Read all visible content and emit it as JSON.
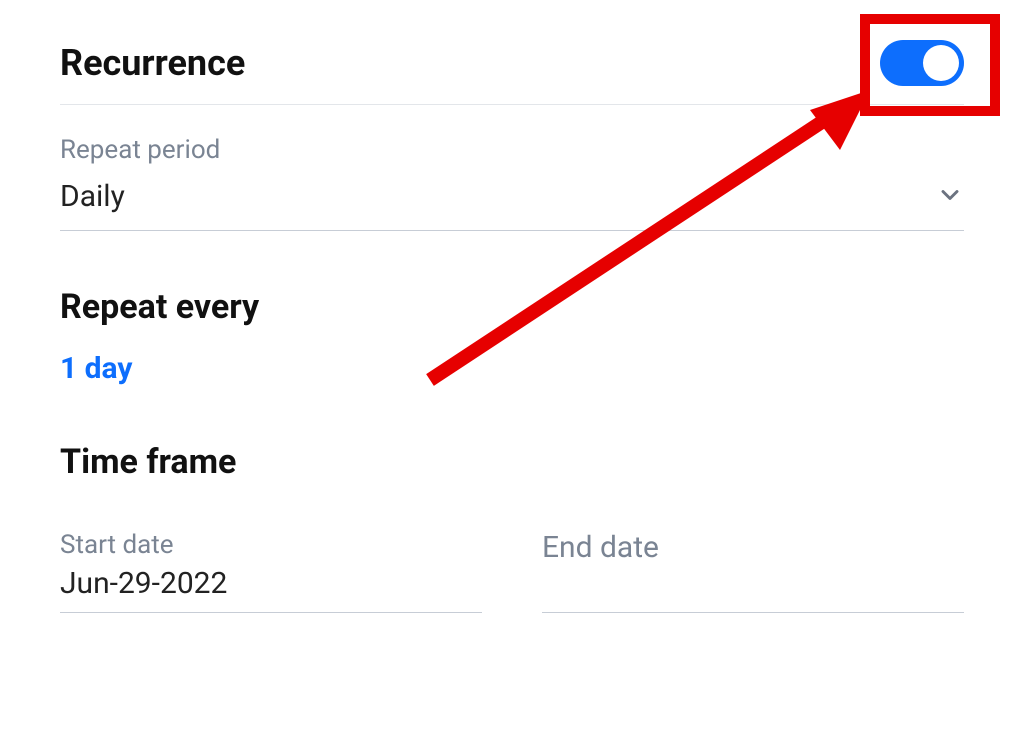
{
  "recurrence": {
    "title": "Recurrence",
    "toggle_on": true
  },
  "repeat_period": {
    "label": "Repeat period",
    "value": "Daily"
  },
  "repeat_every": {
    "title": "Repeat every",
    "value": "1 day"
  },
  "time_frame": {
    "title": "Time frame",
    "start": {
      "label": "Start date",
      "value": "Jun-29-2022"
    },
    "end": {
      "label": "End date",
      "value": ""
    }
  }
}
